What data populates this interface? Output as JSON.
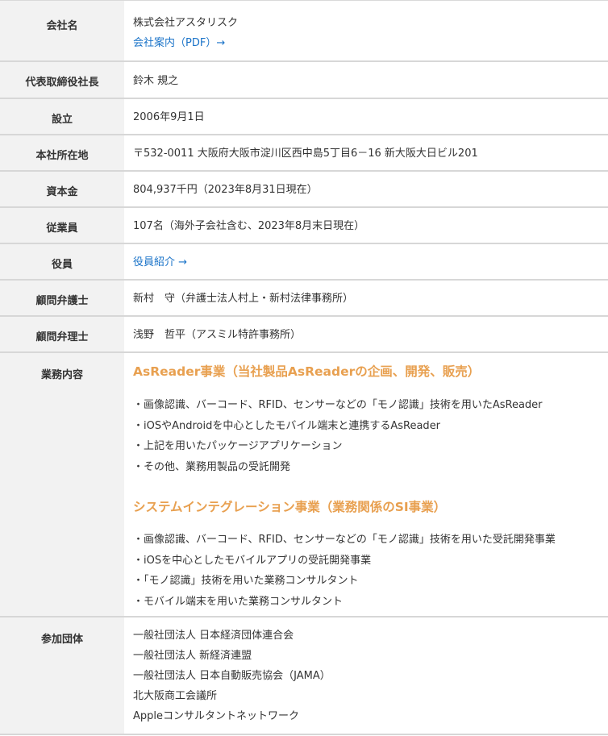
{
  "rows": {
    "company": {
      "label": "会社名",
      "name": "株式会社アスタリスク",
      "pdf_link": "会社案内（PDF）→"
    },
    "ceo": {
      "label": "代表取締役社長",
      "value": "鈴木 規之"
    },
    "founded": {
      "label": "設立",
      "value": "2006年9月1日"
    },
    "address": {
      "label": "本社所在地",
      "value": "〒532-0011 大阪府大阪市淀川区西中島5丁目6－16 新大阪大日ビル201"
    },
    "capital": {
      "label": "資本金",
      "value": "804,937千円（2023年8月31日現在）"
    },
    "employees": {
      "label": "従業員",
      "value": "107名（海外子会社含む、2023年8月末日現在）"
    },
    "officers": {
      "label": "役員",
      "link": "役員紹介 →"
    },
    "lawyer": {
      "label": "顧問弁護士",
      "value": "新村　守（弁護士法人村上・新村法律事務所）"
    },
    "patent": {
      "label": "顧問弁理士",
      "value": "浅野　哲平（アスミル特許事務所）"
    },
    "business": {
      "label": "業務内容",
      "asreader_heading": "AsReader事業（当社製品AsReaderの企画、開発、販売）",
      "asreader_items": [
        "・画像認識、バーコード、RFID、センサーなどの「モノ認識」技術を用いたAsReader",
        "・iOSやAndroidを中心としたモバイル端末と連携するAsReader",
        "・上記を用いたパッケージアプリケーション",
        "・その他、業務用製品の受託開発"
      ],
      "si_heading": "システムインテグレーション事業（業務関係のSI事業）",
      "si_items": [
        "・画像認識、バーコード、RFID、センサーなどの「モノ認識」技術を用いた受託開発事業",
        "・iOSを中心としたモバイルアプリの受託開発事業",
        "・「モノ認識」技術を用いた業務コンサルタント",
        "・モバイル端末を用いた業務コンサルタント"
      ]
    },
    "groups": {
      "label": "参加団体",
      "items": [
        "一般社団法人 日本経済団体連合会",
        "一般社団法人 新経済連盟",
        "一般社団法人 日本自動販売協会（JAMA）",
        "北大阪商工会議所",
        "Appleコンサルタントネットワーク"
      ]
    }
  },
  "colors": {
    "header_bg": "#f2f2f2",
    "link": "#1a73c8",
    "section_heading": "#e8a050",
    "border": "#d7d7d7"
  }
}
